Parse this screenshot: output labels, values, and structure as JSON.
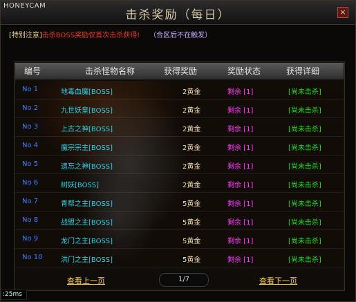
{
  "watermark": "HONEYCAM",
  "window": {
    "title": "击杀奖励（每日）",
    "close_label": "×"
  },
  "notice": {
    "label": "[特别注意]",
    "message": "击杀BOSS奖励仅首次击杀获得!",
    "sub": "（合区后不在触发）"
  },
  "table": {
    "headers": [
      "编号",
      "击杀怪物名称",
      "获得奖励",
      "奖励状态",
      "获得详细"
    ],
    "rows": [
      {
        "no": "No 1",
        "name": "地毒血魔[BOSS]",
        "reward": "2黄金",
        "status": "剩余 [1]",
        "detail": "[尚未击杀]"
      },
      {
        "no": "No 2",
        "name": "九世妖皇[BOSS]",
        "reward": "2黄金",
        "status": "剩余 [1]",
        "detail": "[尚未击杀]"
      },
      {
        "no": "No 3",
        "name": "上古之神[BOSS]",
        "reward": "2黄金",
        "status": "剩余 [1]",
        "detail": "[尚未击杀]"
      },
      {
        "no": "No 4",
        "name": "魔宗宗主[BOSS]",
        "reward": "2黄金",
        "status": "剩余 [1]",
        "detail": "[尚未击杀]"
      },
      {
        "no": "No 5",
        "name": "遗忘之神[BOSS]",
        "reward": "2黄金",
        "status": "剩余 [1]",
        "detail": "[尚未击杀]"
      },
      {
        "no": "No 6",
        "name": "树妖[BOSS]",
        "reward": "2黄金",
        "status": "剩余 [1]",
        "detail": "[尚未击杀]"
      },
      {
        "no": "No 7",
        "name": "青帮之主[BOSS]",
        "reward": "5黄金",
        "status": "剩余 [1]",
        "detail": "[尚未击杀]"
      },
      {
        "no": "No 8",
        "name": "战盟之主[BOSS]",
        "reward": "5黄金",
        "status": "剩余 [1]",
        "detail": "[尚未击杀]"
      },
      {
        "no": "No 9",
        "name": "龙门之主[BOSS]",
        "reward": "5黄金",
        "status": "剩余 [1]",
        "detail": "[尚未击杀]"
      },
      {
        "no": "No 10",
        "name": "洪门之主[BOSS]",
        "reward": "5黄金",
        "status": "剩余 [1]",
        "detail": "[尚未击杀]"
      }
    ]
  },
  "pager": {
    "prev": "查看上一页",
    "page": "1/7",
    "next": "查看下一页"
  },
  "timer": ":25ms",
  "colors": {
    "number": "#3e7fff",
    "name": "#2ed0e6",
    "status": "#ff3aff",
    "detail": "#22dd22",
    "link": "#f7cc55",
    "warning": "#ff3a26"
  }
}
